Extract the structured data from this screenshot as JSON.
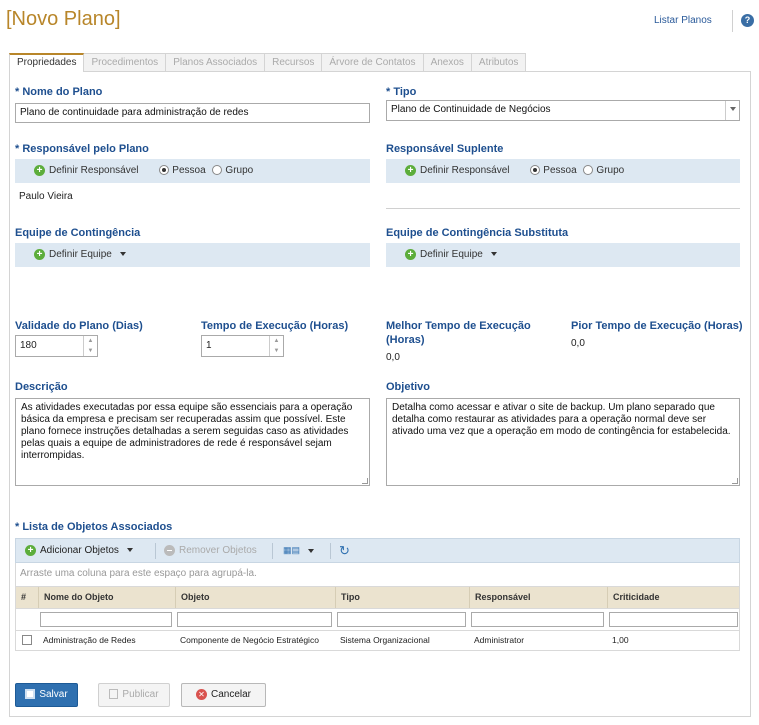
{
  "page": {
    "title": "[Novo Plano]",
    "list_link": "Listar Planos",
    "help_icon": "help-icon"
  },
  "tabs": [
    {
      "label": "Propriedades"
    },
    {
      "label": "Procedimentos"
    },
    {
      "label": "Planos Associados"
    },
    {
      "label": "Recursos"
    },
    {
      "label": "Árvore de Contatos"
    },
    {
      "label": "Anexos"
    },
    {
      "label": "Atributos"
    }
  ],
  "form": {
    "name": {
      "label": "* Nome do Plano",
      "value": "Plano de continuidade para administração de redes"
    },
    "type": {
      "label": "* Tipo",
      "value": "Plano de Continuidade de Negócios"
    },
    "responsible": {
      "label": "* Responsável pelo Plano",
      "define": "Definir Responsável",
      "opt_person": "Pessoa",
      "opt_group": "Grupo",
      "selected": "Pessoa",
      "value": "Paulo Vieira"
    },
    "substitute": {
      "label": "Responsável Suplente",
      "define": "Definir Responsável",
      "opt_person": "Pessoa",
      "opt_group": "Grupo",
      "selected": "Pessoa"
    },
    "team": {
      "label": "Equipe de Contingência",
      "define": "Definir Equipe"
    },
    "team_sub": {
      "label": "Equipe de Contingência Substituta",
      "define": "Definir Equipe"
    },
    "validity": {
      "label": "Validade do Plano (Dias)",
      "value": "180"
    },
    "exec_time": {
      "label": "Tempo de Execução (Horas)",
      "value": "1"
    },
    "best_time": {
      "label_1": "Melhor Tempo de Execução",
      "label_2": "(Horas)",
      "value": "0,0"
    },
    "worst_time": {
      "label": "Pior Tempo de Execução (Horas)",
      "value": "0,0"
    },
    "description": {
      "label": "Descrição",
      "value": "As atividades executadas por essa equipe são essenciais para a operação básica da empresa e precisam ser recuperadas assim que possível. Este plano fornece instruções detalhadas a serem seguidas caso as atividades pelas quais a equipe de administradores de rede é responsável sejam interrompidas."
    },
    "objective": {
      "label": "Objetivo",
      "value": "Detalha como acessar e ativar o site de backup. Um plano separado que detalha como restaurar as atividades para a operação normal deve ser ativado uma vez que a operação em modo de contingência for estabelecida."
    }
  },
  "objects": {
    "label": "* Lista de Objetos Associados",
    "toolbar": {
      "add": "Adicionar Objetos",
      "remove": "Remover Objetos"
    },
    "group_hint": "Arraste uma coluna para este espaço para agrupá-la.",
    "columns": [
      "#",
      "Nome do Objeto",
      "Objeto",
      "Tipo",
      "Responsável",
      "Criticidade"
    ],
    "rows": [
      {
        "name": "Administração de Redes",
        "object": "Componente de Negócio Estratégico",
        "type": "Sistema Organizacional",
        "responsible": "Administrator",
        "criticality": "1,00"
      }
    ]
  },
  "actions": {
    "save": "Salvar",
    "publish": "Publicar",
    "cancel": "Cancelar"
  },
  "colors": {
    "title": "#b8862a",
    "label": "#1e4f8f",
    "bar": "#dde8f2",
    "primary": "#2f70b0"
  }
}
